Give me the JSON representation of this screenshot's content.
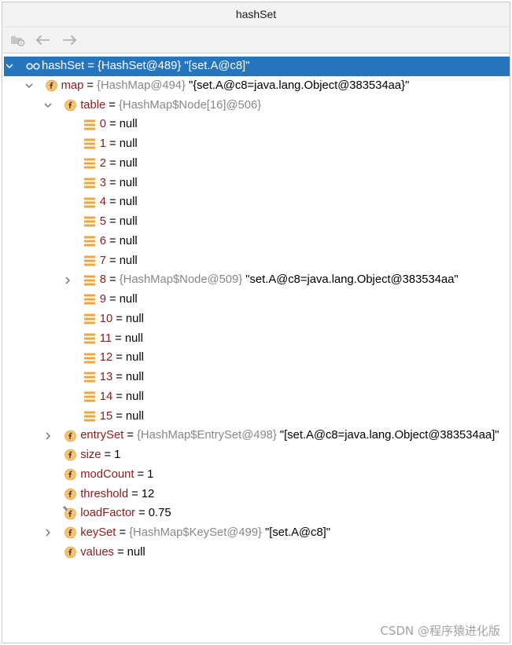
{
  "window": {
    "title": "hashSet"
  },
  "toolbar": {
    "buttons": [
      {
        "icon": "folder-icon",
        "enabled": false
      },
      {
        "icon": "back-arrow-icon",
        "enabled": false
      },
      {
        "icon": "forward-arrow-icon",
        "enabled": false
      }
    ]
  },
  "tree": {
    "separator": "=",
    "nodes": [
      {
        "name": "hashSet",
        "type": "{HashSet@489}",
        "value": "\"[set.A@c8]\"",
        "icon": "watch-icon",
        "expanded": true,
        "selected": true,
        "children": [
          {
            "name": "map",
            "type": "{HashMap@494}",
            "value": "\"{set.A@c8=java.lang.Object@383534aa}\"",
            "icon": "field-icon",
            "expanded": true,
            "children": [
              {
                "name": "table",
                "type": "{HashMap$Node[16]@506}",
                "icon": "field-icon",
                "expanded": true,
                "children": [
                  {
                    "name": "0",
                    "value": "null",
                    "icon": "array-element-icon"
                  },
                  {
                    "name": "1",
                    "value": "null",
                    "icon": "array-element-icon"
                  },
                  {
                    "name": "2",
                    "value": "null",
                    "icon": "array-element-icon"
                  },
                  {
                    "name": "3",
                    "value": "null",
                    "icon": "array-element-icon"
                  },
                  {
                    "name": "4",
                    "value": "null",
                    "icon": "array-element-icon"
                  },
                  {
                    "name": "5",
                    "value": "null",
                    "icon": "array-element-icon"
                  },
                  {
                    "name": "6",
                    "value": "null",
                    "icon": "array-element-icon"
                  },
                  {
                    "name": "7",
                    "value": "null",
                    "icon": "array-element-icon"
                  },
                  {
                    "name": "8",
                    "type": "{HashMap$Node@509}",
                    "value": "\"set.A@c8=java.lang.Object@383534aa\"",
                    "icon": "array-element-icon",
                    "expanded": false
                  },
                  {
                    "name": "9",
                    "value": "null",
                    "icon": "array-element-icon"
                  },
                  {
                    "name": "10",
                    "value": "null",
                    "icon": "array-element-icon"
                  },
                  {
                    "name": "11",
                    "value": "null",
                    "icon": "array-element-icon"
                  },
                  {
                    "name": "12",
                    "value": "null",
                    "icon": "array-element-icon"
                  },
                  {
                    "name": "13",
                    "value": "null",
                    "icon": "array-element-icon"
                  },
                  {
                    "name": "14",
                    "value": "null",
                    "icon": "array-element-icon"
                  },
                  {
                    "name": "15",
                    "value": "null",
                    "icon": "array-element-icon"
                  }
                ]
              },
              {
                "name": "entrySet",
                "type": "{HashMap$EntrySet@498}",
                "value": "\"[set.A@c8=java.lang.Object@383534aa]\"",
                "icon": "field-icon",
                "expanded": false
              },
              {
                "name": "size",
                "value": "1",
                "icon": "field-icon"
              },
              {
                "name": "modCount",
                "value": "1",
                "icon": "field-icon"
              },
              {
                "name": "threshold",
                "value": "12",
                "icon": "field-icon"
              },
              {
                "name": "loadFactor",
                "value": "0.75",
                "icon": "final-field-icon"
              },
              {
                "name": "keySet",
                "type": "{HashMap$KeySet@499}",
                "value": "\"[set.A@c8]\"",
                "icon": "field-icon",
                "expanded": false
              },
              {
                "name": "values",
                "value": "null",
                "icon": "field-icon"
              }
            ]
          }
        ]
      }
    ]
  },
  "colors": {
    "selection": "#2675bf",
    "name": "#8a1c1c",
    "type": "#878787",
    "value": "#000000",
    "field_icon": "#f5c372",
    "array_icon": "#eea73d"
  },
  "watermark": "CSDN @程序猿进化版"
}
